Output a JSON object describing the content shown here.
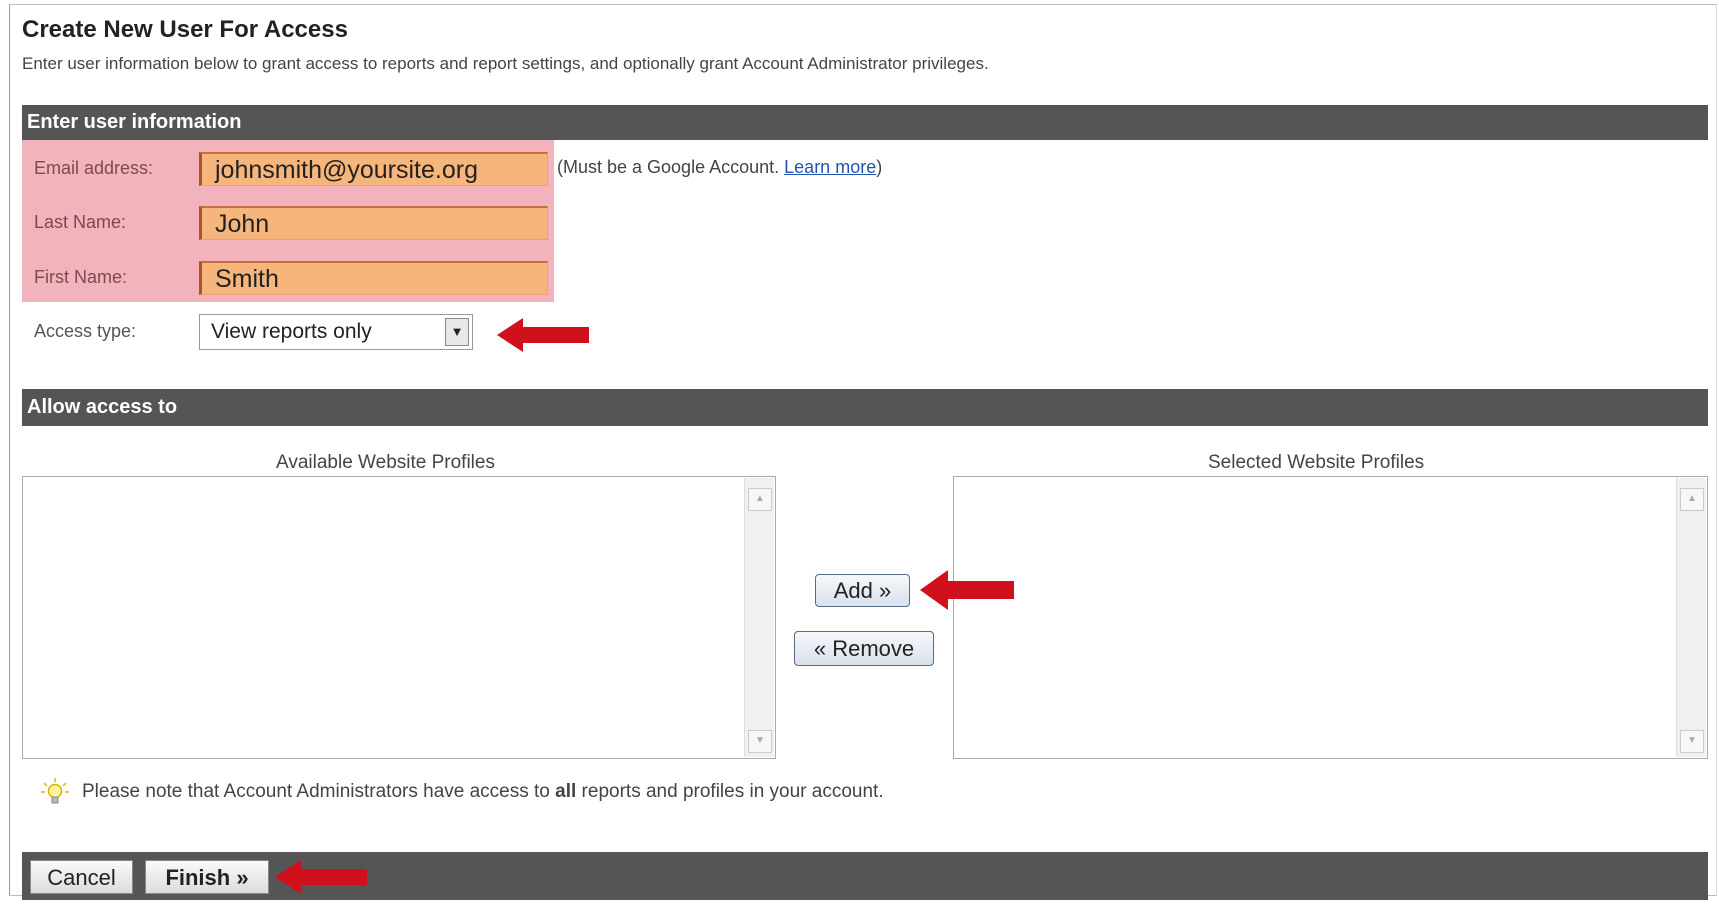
{
  "page": {
    "title": "Create New User For Access",
    "subtitle": "Enter user information below to grant access to reports and report settings, and optionally grant Account Administrator privileges."
  },
  "user_info": {
    "header": "Enter user information",
    "email_label": "Email address:",
    "email_value": "johnsmith@yoursite.org",
    "email_hint": "(Must be a Google Account.",
    "email_hint_link": "Learn more",
    "email_hint_close": ")",
    "last_name_label": "Last Name:",
    "last_name_value": "John",
    "first_name_label": "First Name:",
    "first_name_value": "Smith",
    "access_type_label": "Access type:",
    "access_type_value": "View reports only"
  },
  "access": {
    "header": "Allow access to",
    "available_label": "Available Website Profiles",
    "selected_label": "Selected Website Profiles",
    "add_button": "Add »",
    "remove_button": "« Remove"
  },
  "note": {
    "before": "Please note that Account Administrators have access to ",
    "bold": "all",
    "after": " reports and profiles in your account."
  },
  "footer": {
    "cancel_button": "Cancel",
    "finish_button": "Finish »"
  },
  "colors": {
    "header_bar": "#555555",
    "highlight_pink": "#f3b3bc",
    "highlight_orange": "#f6b57b",
    "annotation_arrow": "#d0101c",
    "link": "#2255aa"
  }
}
